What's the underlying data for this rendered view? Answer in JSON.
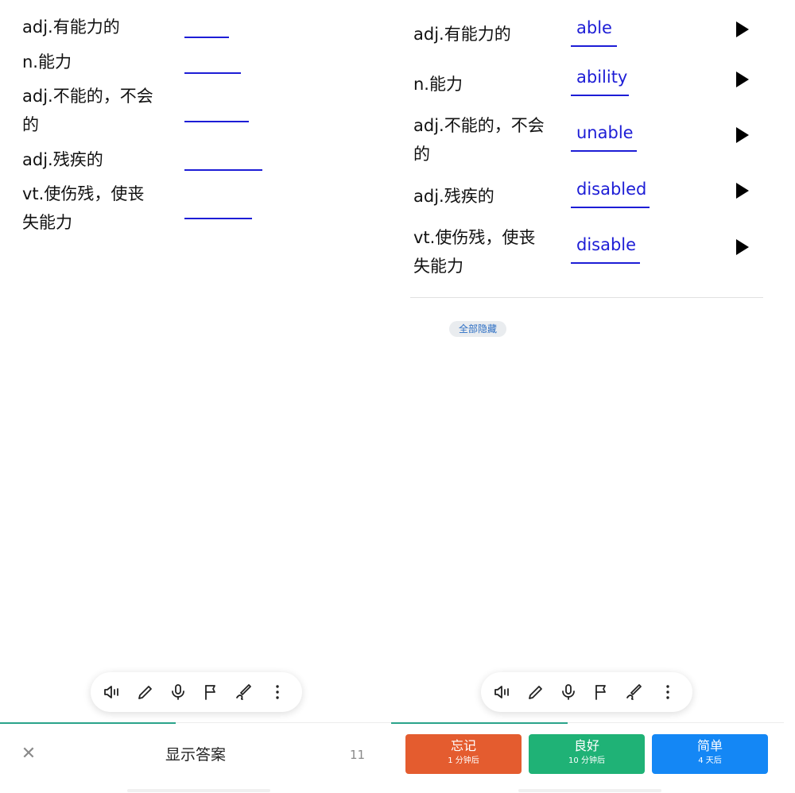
{
  "question": {
    "items": [
      {
        "text": "adj.有能力的"
      },
      {
        "text": "n.能力"
      },
      {
        "text": "adj.不能的，不会的"
      },
      {
        "text": "adj.残疾的"
      },
      {
        "text": "vt.使伤残，使丧失能力"
      }
    ]
  },
  "answer": {
    "items": [
      {
        "meaning": "adj.有能力的",
        "word": "able"
      },
      {
        "meaning": "n.能力",
        "word": "ability"
      },
      {
        "meaning": "adj.不能的，不会的",
        "word": "unable"
      },
      {
        "meaning": "adj.残疾的",
        "word": "disabled"
      },
      {
        "meaning": "vt.使伤残，使丧失能力",
        "word": "disable"
      }
    ],
    "hide_all_label": "全部隐藏"
  },
  "toolbar": {
    "icons": [
      "speaker-icon",
      "pencil-icon",
      "microphone-icon",
      "flag-icon",
      "pen-icon",
      "more-vertical-icon"
    ]
  },
  "bottom_left": {
    "close_symbol": "✕",
    "show_answer_label": "显示答案",
    "remaining_count": "11",
    "progress": 0.45
  },
  "rating": {
    "buttons": [
      {
        "label": "忘记",
        "interval": "1 分钟后",
        "color": "#e45c2f"
      },
      {
        "label": "良好",
        "interval": "10 分钟后",
        "color": "#1fb276"
      },
      {
        "label": "简单",
        "interval": "4 天后",
        "color": "#1487f5"
      }
    ]
  },
  "colors": {
    "answer_blue": "#1d1dd6",
    "progress_green": "#2aa38a"
  }
}
